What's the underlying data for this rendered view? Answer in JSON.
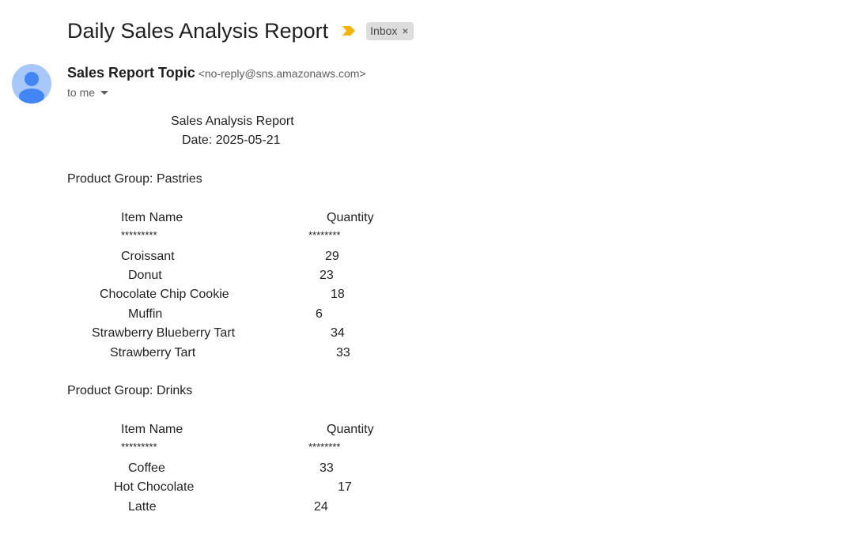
{
  "email": {
    "subject": "Daily Sales Analysis Report",
    "label": "Inbox",
    "label_remove": "×",
    "sender_name": "Sales Report Topic",
    "sender_email": "<no-reply@sns.amazonaws.com>",
    "recipient": "to me"
  },
  "report": {
    "title": "Sales Analysis Report",
    "date": "Date: 2025-05-21",
    "groups": [
      {
        "heading": "Product Group: Pastries",
        "col_item": "Item Name",
        "col_qty": "Quantity",
        "sep_item": "*********",
        "sep_qty": "********",
        "rows": [
          {
            "name": "Croissant",
            "qty": "29"
          },
          {
            "name": "Donut",
            "qty": "23"
          },
          {
            "name": "Chocolate Chip Cookie",
            "qty": "18"
          },
          {
            "name": "Muffin",
            "qty": "6"
          },
          {
            "name": "Strawberry Blueberry Tart",
            "qty": "34"
          },
          {
            "name": "Strawberry Tart",
            "qty": "33"
          }
        ]
      },
      {
        "heading": "Product Group: Drinks",
        "col_item": "Item Name",
        "col_qty": "Quantity",
        "sep_item": "*********",
        "sep_qty": "********",
        "rows": [
          {
            "name": "Coffee",
            "qty": "33"
          },
          {
            "name": "Hot Chocolate",
            "qty": "17"
          },
          {
            "name": "Latte",
            "qty": "24"
          }
        ]
      }
    ]
  },
  "colors": {
    "importance_marker": "#f4b400",
    "avatar_bg": "#a8c7fa",
    "avatar_fg": "#4285f4"
  }
}
